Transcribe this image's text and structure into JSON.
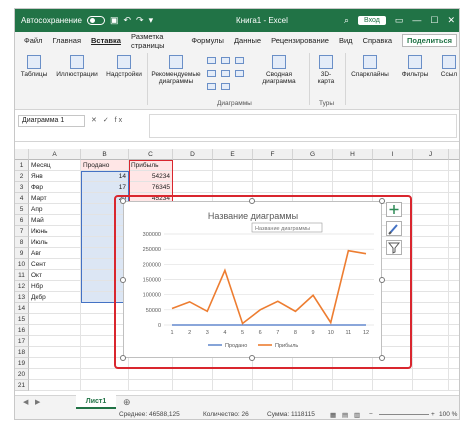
{
  "titlebar": {
    "autosave": "Автосохранение",
    "title": "Книга1 - Excel",
    "login": "Вход"
  },
  "tabs": [
    "Файл",
    "Главная",
    "Вставка",
    "Разметка страницы",
    "Формулы",
    "Данные",
    "Рецензирование",
    "Вид",
    "Справка"
  ],
  "active_tab": "Вставка",
  "share": "Поделиться",
  "ribbon": {
    "tables": "Таблицы",
    "illustrations": "Иллюстрации",
    "addins": "Надстройки",
    "rec_charts_1": "Рекомендуемые",
    "rec_charts_2": "диаграммы",
    "pivot_chart_1": "Сводная",
    "pivot_chart_2": "диаграмма",
    "map_1": "3D-",
    "map_2": "карта",
    "sparklines": "Спарклайны",
    "filters": "Фильтры",
    "links": "Ссыл",
    "group_charts": "Диаграммы",
    "group_tours": "Туры"
  },
  "namebox": "Диаграмма 1",
  "fx_label": "fx",
  "grid": {
    "columns": [
      "A",
      "B",
      "C",
      "D",
      "E",
      "F",
      "G",
      "H",
      "I",
      "J",
      "K"
    ],
    "rows": [
      "1",
      "2",
      "3",
      "4",
      "5",
      "6",
      "7",
      "8",
      "9",
      "10",
      "11",
      "12",
      "13",
      "14",
      "15",
      "16",
      "17",
      "18",
      "19",
      "20",
      "21"
    ],
    "header": [
      "Месяц",
      "Продано",
      "Прибыль"
    ],
    "months": [
      "Янв",
      "Фвр",
      "Март",
      "Апр",
      "Май",
      "Июнь",
      "Июль",
      "Авг",
      "Сент",
      "Окт",
      "Нбр",
      "Дкбр"
    ],
    "sold": [
      "14",
      "17",
      "20"
    ],
    "profit": [
      "54234",
      "76345",
      "45234"
    ]
  },
  "chart_data": {
    "type": "line",
    "title": "Название диаграммы",
    "tooltip": "Название диаграммы",
    "categories": [
      "1",
      "2",
      "3",
      "4",
      "5",
      "6",
      "7",
      "8",
      "9",
      "10",
      "11",
      "12"
    ],
    "yticks": [
      "0",
      "50000",
      "100000",
      "150000",
      "200000",
      "250000",
      "300000"
    ],
    "ylim": [
      0,
      300000
    ],
    "grid": true,
    "legend_position": "bottom",
    "series": [
      {
        "name": "Продано",
        "color": "#4472c4",
        "values": [
          14,
          17,
          20,
          18,
          22,
          19,
          21,
          25,
          23,
          20,
          18,
          24
        ]
      },
      {
        "name": "Прибыль",
        "color": "#ed7d31",
        "values": [
          54234,
          76345,
          45234,
          180000,
          5000,
          50000,
          78000,
          45000,
          98000,
          8000,
          245000,
          235000
        ]
      }
    ]
  },
  "sheet_tab": "Лист1",
  "status": {
    "avg": "Среднее: 46588,125",
    "count": "Количество: 26",
    "sum": "Сумма: 1118115",
    "zoom": "100 %"
  },
  "colors": {
    "brand": "#217346",
    "highlight": "#d9262e"
  }
}
